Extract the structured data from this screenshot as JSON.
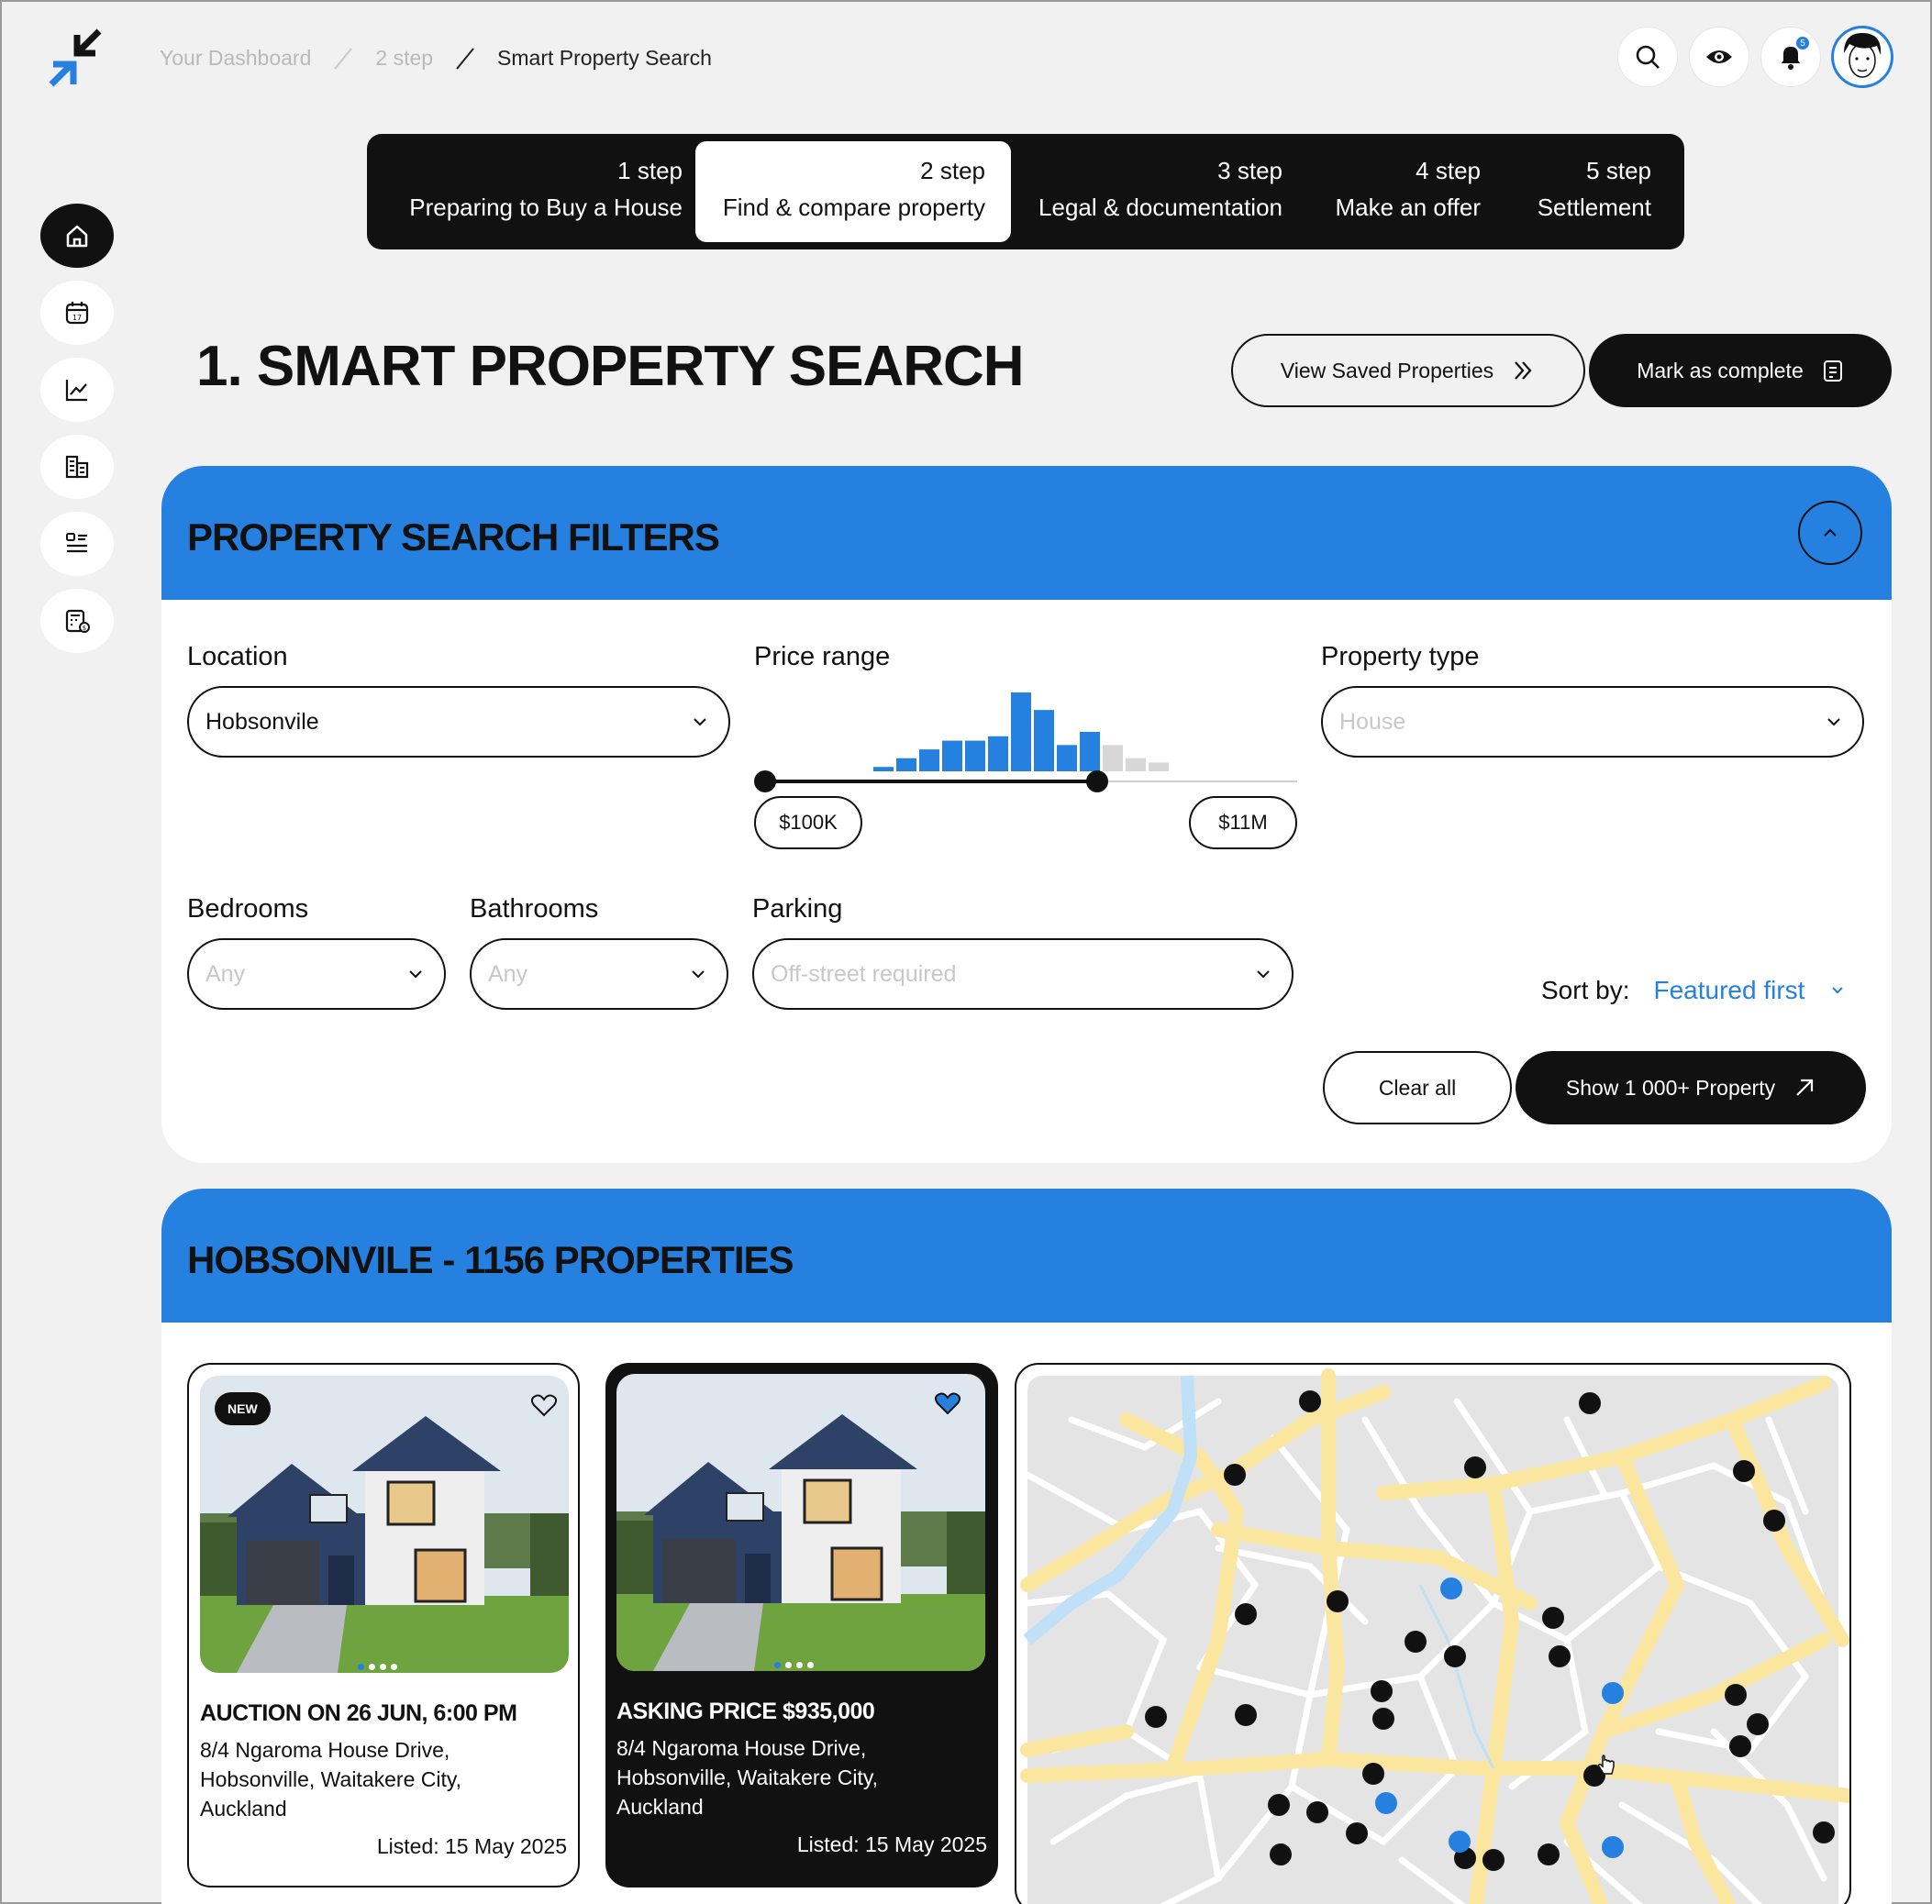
{
  "breadcrumb": {
    "item1": "Your Dashboard",
    "item2": "2 step",
    "current": "Smart Property Search"
  },
  "notifications": {
    "count": "5"
  },
  "steps": [
    {
      "num": "1 step",
      "label": "Preparing to Buy a House"
    },
    {
      "num": "2 step",
      "label": "Find & compare property"
    },
    {
      "num": "3 step",
      "label": "Legal & documentation"
    },
    {
      "num": "4 step",
      "label": "Make an offer"
    },
    {
      "num": "5 step",
      "label": "Settlement"
    }
  ],
  "page": {
    "title": "1. SMART PROPERTY SEARCH",
    "saved_label": "View Saved Properties",
    "complete_label": "Mark as complete"
  },
  "filters": {
    "title": "PROPERTY SEARCH FILTERS",
    "location_label": "Location",
    "location_value": "Hobsonvile",
    "price_label": "Price range",
    "price_min": "$100K",
    "price_max": "$11M",
    "histogram": [
      1,
      3,
      5,
      7,
      7,
      8,
      18,
      14,
      6,
      9,
      6,
      3,
      2
    ],
    "histogram_selected_count": 10,
    "property_type_label": "Property type",
    "property_type_placeholder": "House",
    "bedrooms_label": "Bedrooms",
    "bedrooms_placeholder": "Any",
    "bathrooms_label": "Bathrooms",
    "bathrooms_placeholder": "Any",
    "parking_label": "Parking",
    "parking_placeholder": "Off-street required",
    "sort_label": "Sort by:",
    "sort_value": "Featured first",
    "clear_label": "Clear all",
    "show_label": "Show 1 000+ Property"
  },
  "results": {
    "title": "HOBSONVILE - 1156 PROPERTIES",
    "cards": [
      {
        "badge": "NEW",
        "title": "AUCTION ON 26 JUN, 6:00 PM",
        "address": "8/4 Ngaroma House Drive, Hobsonville, Waitakere City, Auckland",
        "listed": "Listed: 15 May 2025",
        "favorited": false
      },
      {
        "title": "ASKING PRICE $935,000",
        "address": "8/4 Ngaroma House Drive, Hobsonville, Waitakere City, Auckland",
        "listed": "Listed: 15 May 2025",
        "favorited": true
      }
    ]
  },
  "colors": {
    "accent": "#2680e0",
    "dark": "#111111",
    "road": "#fbe6a0",
    "map_bg": "#e4e4e4"
  }
}
